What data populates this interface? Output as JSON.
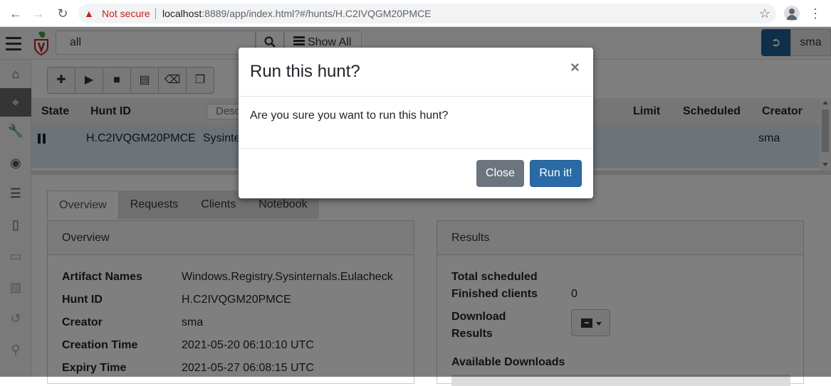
{
  "browser": {
    "security_label": "Not secure",
    "url_host": "localhost",
    "url_rest": ":8889/app/index.html?#/hunts/H.C2IVQGM20PMCE"
  },
  "topbar": {
    "search_value": "all",
    "show_all_label": "Show All",
    "user_label": "sma"
  },
  "hunt_table": {
    "columns": {
      "state": "State",
      "hunt_id": "Hunt ID",
      "description": "Desc",
      "limit": "Limit",
      "scheduled": "Scheduled",
      "creator": "Creator"
    },
    "row": {
      "hunt_id": "H.C2IVQGM20PMCE",
      "description": "Sysinte",
      "creator": "sma"
    }
  },
  "tabs": [
    "Overview",
    "Requests",
    "Clients",
    "Notebook"
  ],
  "overview": {
    "title": "Overview",
    "fields": [
      {
        "key": "Artifact Names",
        "value": "Windows.Registry.Sysinternals.Eulacheck"
      },
      {
        "key": "Hunt ID",
        "value": "H.C2IVQGM20PMCE"
      },
      {
        "key": "Creator",
        "value": "sma"
      },
      {
        "key": "Creation Time",
        "value": "2021-05-20 06:10:10 UTC"
      },
      {
        "key": "Expiry Time",
        "value": "2021-05-27 06:08:15 UTC"
      }
    ]
  },
  "results": {
    "title": "Results",
    "total_scheduled_label": "Total scheduled",
    "total_scheduled_value": "",
    "finished_clients_label": "Finished clients",
    "finished_clients_value": "0",
    "download_results_line1": "Download",
    "download_results_line2": "Results",
    "available_downloads_label": "Available Downloads"
  },
  "modal": {
    "title": "Run this hunt?",
    "close_glyph": "×",
    "body": "Are you sure you want to run this hunt?",
    "close_label": "Close",
    "run_label": "Run it!"
  },
  "colors": {
    "primary": "#2a6aa6",
    "secondary": "#6c757d",
    "selected_row": "#d9e9f5",
    "logout_button": "#1f5e96"
  }
}
